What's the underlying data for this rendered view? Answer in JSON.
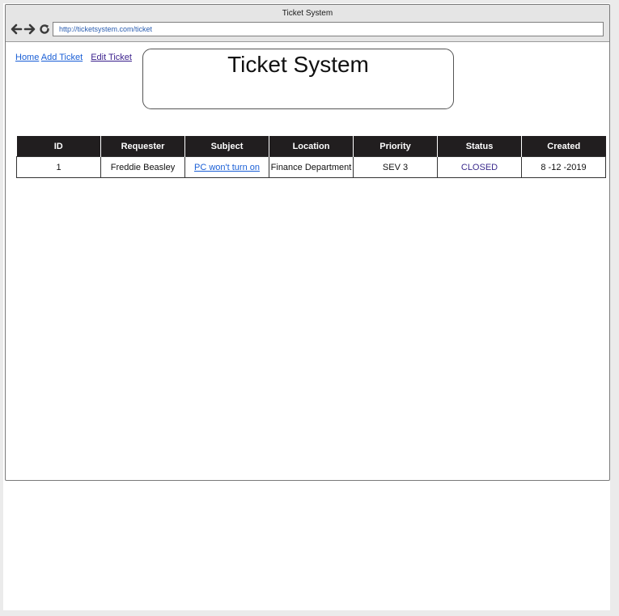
{
  "window": {
    "title": "Ticket System"
  },
  "address_bar": {
    "url": "http://ticketsystem.com/ticket"
  },
  "nav": {
    "home": "Home",
    "add_ticket": "Add Ticket",
    "edit_ticket": "Edit Ticket"
  },
  "header": {
    "title": "Ticket System"
  },
  "table": {
    "columns": [
      "ID",
      "Requester",
      "Subject",
      "Location",
      "Priority",
      "Status",
      "Created"
    ],
    "rows": [
      {
        "id": "1",
        "requester": "Freddie Beasley",
        "subject": "PC won't turn on",
        "location": "Finance Department",
        "priority": "SEV 3",
        "status": "CLOSED",
        "created": "8 -12 -2019"
      }
    ]
  },
  "icons": {
    "back": "arrow-left-icon",
    "forward": "arrow-right-icon",
    "reload": "reload-icon"
  },
  "colors": {
    "link": "#1a5fd6",
    "header_bg": "#211e1f",
    "status_closed": "#3a2a8c"
  }
}
